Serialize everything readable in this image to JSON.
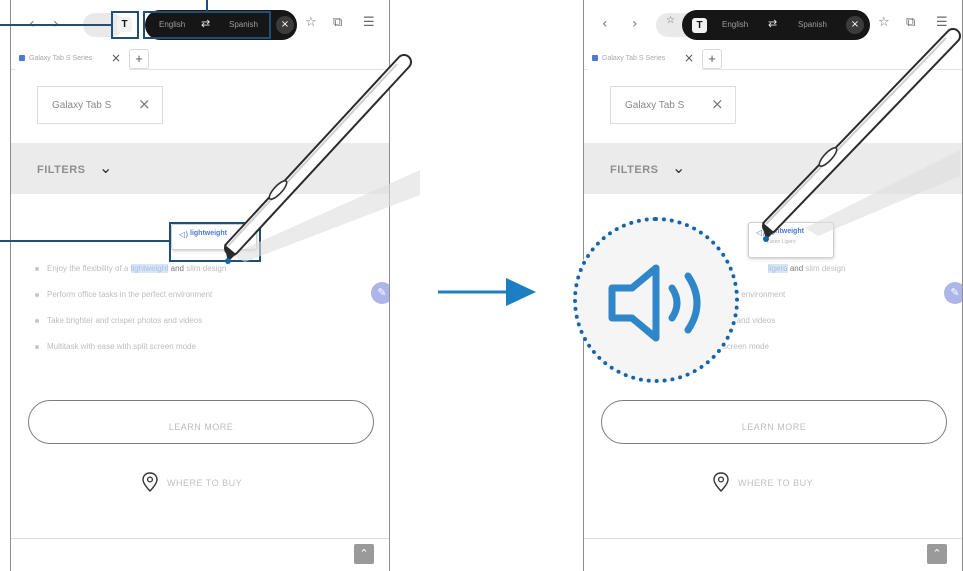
{
  "colors": {
    "accent": "#1f4e79",
    "arrow": "#1c7fc1",
    "speaker": "#2f86c8",
    "highlight": "#4b78d6"
  },
  "left_screen": {
    "nav": {
      "back_icon": "chevron-left-icon",
      "forward_icon": "chevron-right-icon"
    },
    "toolbar": {
      "translate_icon_label": "T",
      "star_icon": "star-icon",
      "tabs_icon": "tabs-icon",
      "menu_icon": "menu-icon"
    },
    "translate_bar": {
      "source_lang": "English",
      "swap_icon": "swap-icon",
      "target_lang": "Spanish",
      "close_label": "×"
    },
    "tab": {
      "title": "Galaxy Tab S Series",
      "close_label": "×",
      "add_label": "+"
    },
    "search_chip": {
      "text": "Galaxy Tab S",
      "close_label": "×"
    },
    "filters": {
      "label": "FILTERS",
      "chevron": "⌄"
    },
    "popup": {
      "speaker": "◁)",
      "word": "lightweight"
    },
    "bullets": [
      {
        "before": "Enjoy the flexibility of a",
        "highlight": "lightweight",
        "middle": "and",
        "after": "slim design"
      },
      {
        "before": "Perform office tasks in the perfect environment",
        "highlight": "",
        "middle": "",
        "after": ""
      },
      {
        "before": "Take brighter and crisper photos and videos",
        "highlight": "",
        "middle": "",
        "after": ""
      },
      {
        "before": "Multitask with ease with split screen mode",
        "highlight": "",
        "middle": "",
        "after": ""
      }
    ],
    "learn_more": "LEARN MORE",
    "where_to_buy": "WHERE TO BUY",
    "scroll_top": "⌃",
    "pen_fab": "✎"
  },
  "right_screen": {
    "nav": {
      "back_label": "‹",
      "forward_label": "›"
    },
    "toolbar": {
      "translate_icon_label": "T",
      "star_icon": "star-icon",
      "tabs_icon": "tabs-icon",
      "menu_icon": "menu-icon"
    },
    "translate_bar": {
      "source_lang": "English",
      "swap_icon": "swap-icon",
      "target_lang": "Spanish",
      "close_label": "×"
    },
    "tab": {
      "title": "Galaxy Tab S Series",
      "close_label": "×",
      "add_label": "+"
    },
    "search_chip": {
      "text": "Galaxy Tab S",
      "close_label": "×"
    },
    "filters": {
      "label": "FILTERS",
      "chevron": "⌄"
    },
    "popup": {
      "speaker": "◁)",
      "word": "lightweight",
      "sub_word": "Ligero",
      "sub_text": "Listen Ligero"
    },
    "bullets": [
      {
        "before": "",
        "highlight": "ligero",
        "middle": "and",
        "after": "slim design"
      },
      {
        "before": "Perform office tasks in the perfect environment",
        "highlight": "",
        "middle": "",
        "after": ""
      },
      {
        "before": "Take brighter and crisper photos and videos",
        "highlight": "",
        "middle": "",
        "after": ""
      },
      {
        "before": "Multitask with ease with split screen mode",
        "highlight": "",
        "middle": "",
        "after": ""
      }
    ],
    "learn_more": "LEARN MORE",
    "where_to_buy": "WHERE TO BUY",
    "scroll_top": "⌃",
    "pen_fab": "✎"
  },
  "magnifier": {
    "icon": "speaker-icon"
  },
  "arrow": {
    "icon": "arrow-right-icon"
  }
}
